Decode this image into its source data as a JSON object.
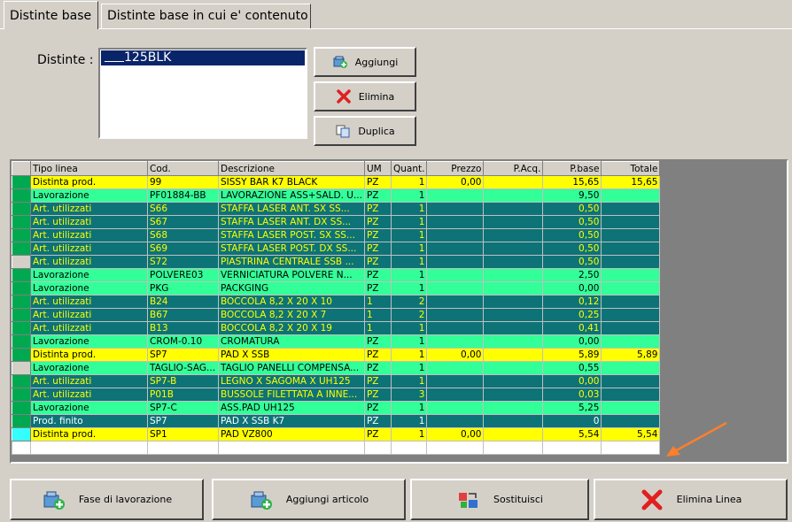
{
  "tabs": [
    {
      "label": "Distinte base",
      "active": true
    },
    {
      "label": "Distinte base in cui e' contenuto",
      "active": false
    }
  ],
  "distinte": {
    "label": "Distinte :",
    "selected": "125BLK"
  },
  "side_buttons": {
    "add": "Aggiungi",
    "delete": "Elimina",
    "duplicate": "Duplica"
  },
  "grid": {
    "columns": [
      "Tipo linea",
      "Cod.",
      "Descrizione",
      "UM",
      "Quant.",
      "Prezzo",
      "P.Acq.",
      "P.base",
      "Totale"
    ],
    "rows": [
      {
        "tipo": "Distinta prod.",
        "cod": "99",
        "desc": "SISSY BAR         K7 BLACK",
        "um": "PZ",
        "quant": "1",
        "prezzo": "0,00",
        "pacq": "",
        "pbase": "15,65",
        "totale": "15,65",
        "style": "yellow",
        "ind": "green"
      },
      {
        "tipo": "Lavorazione",
        "cod": "PF01884-BB",
        "desc": "LAVORAZIONE ASS+SALD. U...",
        "um": "PZ",
        "quant": "1",
        "prezzo": "",
        "pacq": "",
        "pbase": "9,50",
        "totale": "",
        "style": "green",
        "ind": "green"
      },
      {
        "tipo": "Art. utilizzati",
        "cod": "S66",
        "desc": "STAFFA LASER  ANT. SX SS...",
        "um": "PZ",
        "quant": "1",
        "prezzo": "",
        "pacq": "",
        "pbase": "0,50",
        "totale": "",
        "style": "teal",
        "ind": "green"
      },
      {
        "tipo": "Art. utilizzati",
        "cod": "S67",
        "desc": "STAFFA LASER  ANT. DX SS...",
        "um": "PZ",
        "quant": "1",
        "prezzo": "",
        "pacq": "",
        "pbase": "0,50",
        "totale": "",
        "style": "teal",
        "ind": "green"
      },
      {
        "tipo": "Art. utilizzati",
        "cod": "S68",
        "desc": "STAFFA LASER  POST. SX SS...",
        "um": "PZ",
        "quant": "1",
        "prezzo": "",
        "pacq": "",
        "pbase": "0,50",
        "totale": "",
        "style": "teal",
        "ind": "green"
      },
      {
        "tipo": "Art. utilizzati",
        "cod": "S69",
        "desc": "STAFFA LASER  POST. DX SS...",
        "um": "PZ",
        "quant": "1",
        "prezzo": "",
        "pacq": "",
        "pbase": "0,50",
        "totale": "",
        "style": "teal",
        "ind": "green"
      },
      {
        "tipo": "Art. utilizzati",
        "cod": "S72",
        "desc": "PIASTRINA CENTRALE SSB ...",
        "um": "PZ",
        "quant": "1",
        "prezzo": "",
        "pacq": "",
        "pbase": "0,50",
        "totale": "",
        "style": "teal",
        "ind": "grey"
      },
      {
        "tipo": "Lavorazione",
        "cod": "POLVERE03",
        "desc": "VERNICIATURA POLVERE N...",
        "um": "PZ",
        "quant": "1",
        "prezzo": "",
        "pacq": "",
        "pbase": "2,50",
        "totale": "",
        "style": "green",
        "ind": "green"
      },
      {
        "tipo": "Lavorazione",
        "cod": "PKG",
        "desc": "PACKGING",
        "um": "PZ",
        "quant": "1",
        "prezzo": "",
        "pacq": "",
        "pbase": "0,00",
        "totale": "",
        "style": "green",
        "ind": "green"
      },
      {
        "tipo": "Art. utilizzati",
        "cod": "B24",
        "desc": "BOCCOLA 8,2 X 20 X 10",
        "um": "1",
        "quant": "2",
        "prezzo": "",
        "pacq": "",
        "pbase": "0,12",
        "totale": "",
        "style": "teal",
        "ind": "green"
      },
      {
        "tipo": "Art. utilizzati",
        "cod": "B67",
        "desc": "BOCCOLA 8,2 X 20 X 7",
        "um": "1",
        "quant": "2",
        "prezzo": "",
        "pacq": "",
        "pbase": "0,25",
        "totale": "",
        "style": "teal",
        "ind": "green"
      },
      {
        "tipo": "Art. utilizzati",
        "cod": "B13",
        "desc": "BOCCOLA 8,2 X 20 X 19",
        "um": "1",
        "quant": "1",
        "prezzo": "",
        "pacq": "",
        "pbase": "0,41",
        "totale": "",
        "style": "teal",
        "ind": "green"
      },
      {
        "tipo": "Lavorazione",
        "cod": "CROM-0.10",
        "desc": "CROMATURA",
        "um": "PZ",
        "quant": "1",
        "prezzo": "",
        "pacq": "",
        "pbase": "0,00",
        "totale": "",
        "style": "green",
        "ind": "green"
      },
      {
        "tipo": "Distinta prod.",
        "cod": "SP7",
        "desc": "PAD X SSB",
        "um": "PZ",
        "quant": "1",
        "prezzo": "0,00",
        "pacq": "",
        "pbase": "5,89",
        "totale": "5,89",
        "style": "yellow",
        "ind": "green"
      },
      {
        "tipo": "Lavorazione",
        "cod": "TAGLIO-SAG...",
        "desc": "TAGLIO PANELLI COMPENSA...",
        "um": "PZ",
        "quant": "1",
        "prezzo": "",
        "pacq": "",
        "pbase": "0,55",
        "totale": "",
        "style": "green",
        "ind": "grey"
      },
      {
        "tipo": "Art. utilizzati",
        "cod": "SP7-B",
        "desc": "LEGNO X SAGOMA X UH125",
        "um": "PZ",
        "quant": "1",
        "prezzo": "",
        "pacq": "",
        "pbase": "0,00",
        "totale": "",
        "style": "teal",
        "ind": "green"
      },
      {
        "tipo": "Art. utilizzati",
        "cod": "P01B",
        "desc": "BUSSOLE FILETTATA A INNE...",
        "um": "PZ",
        "quant": "3",
        "prezzo": "",
        "pacq": "",
        "pbase": "0,03",
        "totale": "",
        "style": "teal",
        "ind": "green"
      },
      {
        "tipo": "Lavorazione",
        "cod": "SP7-C",
        "desc": "ASS.PAD UH125",
        "um": "PZ",
        "quant": "1",
        "prezzo": "",
        "pacq": "",
        "pbase": "5,25",
        "totale": "",
        "style": "green",
        "ind": "green"
      },
      {
        "tipo": "Prod. finito",
        "cod": "SP7",
        "desc": "PAD X SSB         K7",
        "um": "PZ",
        "quant": "1",
        "prezzo": "",
        "pacq": "",
        "pbase": "0",
        "totale": "",
        "style": "prod",
        "ind": "green"
      },
      {
        "tipo": "Distinta prod.",
        "cod": "SP1",
        "desc": "PAD VZ800",
        "um": "PZ",
        "quant": "1",
        "prezzo": "0,00",
        "pacq": "",
        "pbase": "5,54",
        "totale": "5,54",
        "style": "yellow",
        "ind": "cyan"
      }
    ]
  },
  "bottom_buttons": {
    "phase": "Fase di lavorazione",
    "add_article": "Aggiungi articolo",
    "replace": "Sostituisci",
    "delete_line": "Elimina Linea"
  },
  "colors": {
    "yellow_row": "#ffff00",
    "green_row": "#33ff99",
    "teal_row": "#0d7377",
    "arrow": "#ff7f2a"
  }
}
